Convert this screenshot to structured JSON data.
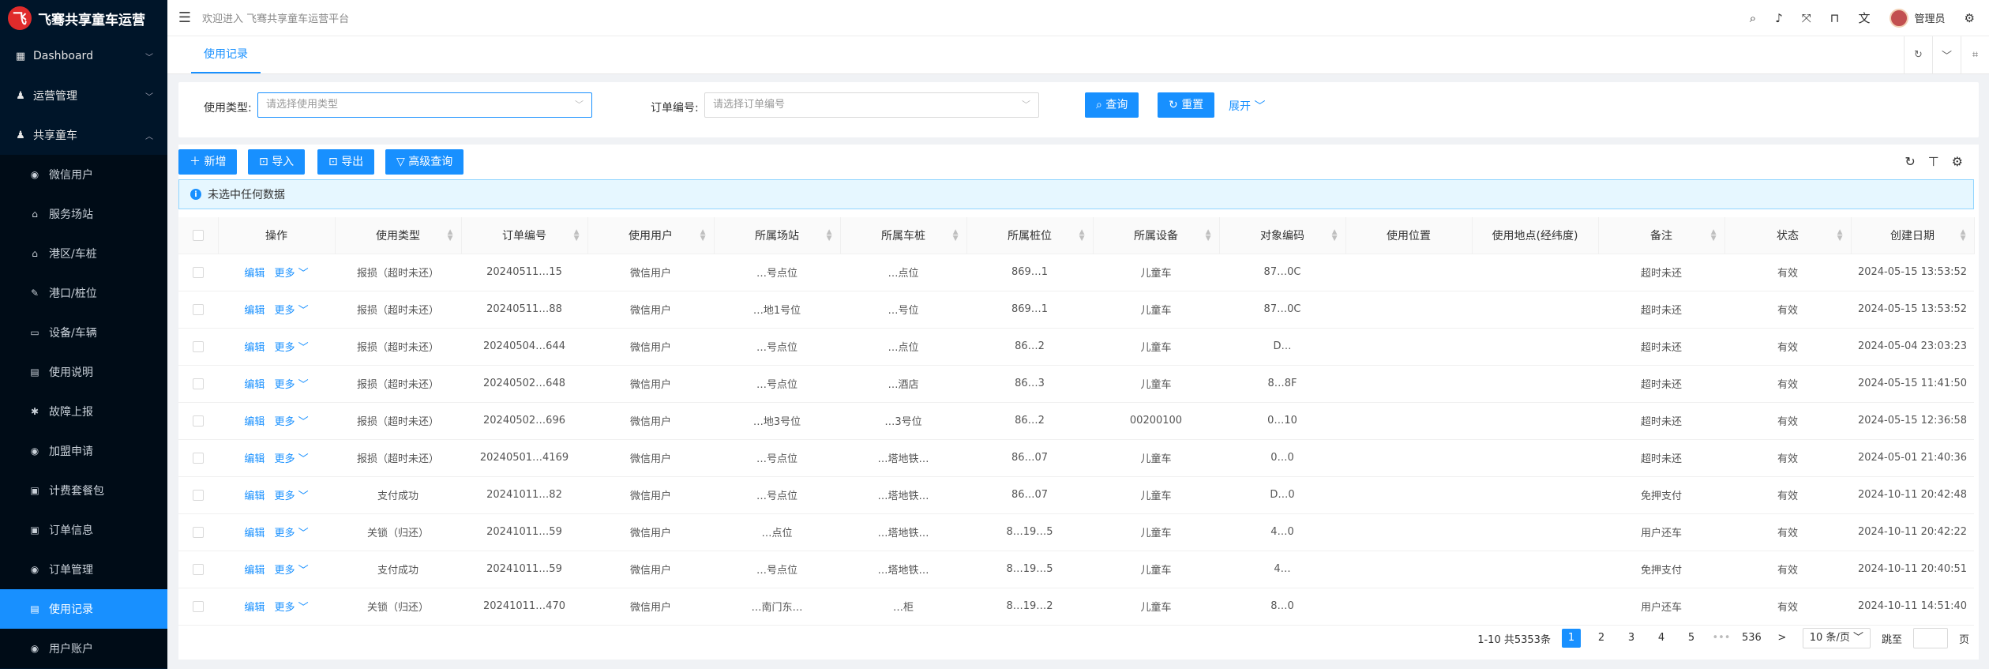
{
  "app": {
    "name": "飞骞共享童车运营",
    "logo_char": "飞"
  },
  "sidebar": {
    "groups": [
      {
        "label": "Dashboard",
        "icon": "dashboard-icon",
        "glyph": "▦",
        "caret": "﹀"
      },
      {
        "label": "运营管理",
        "icon": "user-icon",
        "glyph": "♟",
        "caret": "﹀"
      },
      {
        "label": "共享童车",
        "icon": "user-icon",
        "glyph": "♟",
        "caret": "︿"
      }
    ],
    "items": [
      {
        "label": "微信用户",
        "glyph": "◉"
      },
      {
        "label": "服务场站",
        "glyph": "⌂"
      },
      {
        "label": "港区/车桩",
        "glyph": "⌂"
      },
      {
        "label": "港口/桩位",
        "glyph": "✎"
      },
      {
        "label": "设备/车辆",
        "glyph": "▭"
      },
      {
        "label": "使用说明",
        "glyph": "▤"
      },
      {
        "label": "故障上报",
        "glyph": "✱"
      },
      {
        "label": "加盟申请",
        "glyph": "◉"
      },
      {
        "label": "计费套餐包",
        "glyph": "▣"
      },
      {
        "label": "订单信息",
        "glyph": "▣"
      },
      {
        "label": "订单管理",
        "glyph": "◉"
      },
      {
        "label": "使用记录",
        "glyph": "▤",
        "active": true
      },
      {
        "label": "用户账户",
        "glyph": "◉"
      }
    ]
  },
  "header": {
    "welcome": "欢迎进入 飞骞共享童车运营平台",
    "username": "管理员",
    "icons": [
      "search-icon",
      "bell-icon",
      "fullscreen-icon",
      "lock-icon",
      "language-icon",
      "gear-icon"
    ]
  },
  "tabs": {
    "active": "使用记录"
  },
  "search": {
    "type_label": "使用类型:",
    "type_placeholder": "请选择使用类型",
    "order_label": "订单编号:",
    "order_placeholder": "请选择订单编号",
    "query_label": "查询",
    "reset_label": "重置",
    "expand_label": "展开"
  },
  "toolbar": {
    "add_label": "新增",
    "import_label": "导入",
    "export_label": "导出",
    "advanced_label": "高级查询"
  },
  "alert": {
    "text": "未选中任何数据"
  },
  "table": {
    "columns": [
      "操作",
      "使用类型",
      "订单编号",
      "使用用户",
      "所属场站",
      "所属车桩",
      "所属桩位",
      "所属设备",
      "对象编码",
      "使用位置",
      "使用地点(经纬度)",
      "备注",
      "状态",
      "创建日期"
    ],
    "edit_label": "编辑",
    "more_label": "更多 ﹀",
    "rows": [
      [
        "报损（超时未还）",
        "20240511…15",
        "微信用户",
        "…号点位",
        "…点位",
        "869…1",
        "儿童车",
        "87…0C",
        "",
        "",
        "超时未还",
        "有效",
        "2024-05-15 13:53:52"
      ],
      [
        "报损（超时未还）",
        "20240511…88",
        "微信用户",
        "…地1号位",
        "…号位",
        "869…1",
        "儿童车",
        "87…0C",
        "",
        "",
        "超时未还",
        "有效",
        "2024-05-15 13:53:52"
      ],
      [
        "报损（超时未还）",
        "20240504…644",
        "微信用户",
        "…号点位",
        "…点位",
        "86…2",
        "儿童车",
        "D…",
        "",
        "",
        "超时未还",
        "有效",
        "2024-05-04 23:03:23"
      ],
      [
        "报损（超时未还）",
        "20240502…648",
        "微信用户",
        "…号点位",
        "…酒店",
        "86…3",
        "儿童车",
        "8…8F",
        "",
        "",
        "超时未还",
        "有效",
        "2024-05-15 11:41:50"
      ],
      [
        "报损（超时未还）",
        "20240502…696",
        "微信用户",
        "…地3号位",
        "…3号位",
        "86…2",
        "00200100",
        "0…10",
        "",
        "",
        "超时未还",
        "有效",
        "2024-05-15 12:36:58"
      ],
      [
        "报损（超时未还）",
        "20240501…4169",
        "微信用户",
        "…号点位",
        "…塔地铁…",
        "86…07",
        "儿童车",
        "0…0",
        "",
        "",
        "超时未还",
        "有效",
        "2024-05-01 21:40:36"
      ],
      [
        "支付成功",
        "20241011…82",
        "微信用户",
        "…号点位",
        "…塔地铁…",
        "86…07",
        "儿童车",
        "D…0",
        "",
        "",
        "免押支付",
        "有效",
        "2024-10-11 20:42:48"
      ],
      [
        "关锁（归还）",
        "20241011…59",
        "微信用户",
        "…点位",
        "…塔地铁…",
        "8…19…5",
        "儿童车",
        "4…0",
        "",
        "",
        "用户还车",
        "有效",
        "2024-10-11 20:42:22"
      ],
      [
        "支付成功",
        "20241011…59",
        "微信用户",
        "…号点位",
        "…塔地铁…",
        "8…19…5",
        "儿童车",
        "4…",
        "",
        "",
        "免押支付",
        "有效",
        "2024-10-11 20:40:51"
      ],
      [
        "关锁（归还）",
        "20241011…470",
        "微信用户",
        "…南门东…",
        "…柜",
        "8…19…2",
        "儿童车",
        "8…0",
        "",
        "",
        "用户还车",
        "有效",
        "2024-10-11 14:51:40"
      ]
    ]
  },
  "pagination": {
    "summary": "1-10 共5353条",
    "pages": [
      "1",
      "2",
      "3",
      "4",
      "5"
    ],
    "ellipsis": "•••",
    "last": "536",
    "next": ">",
    "size": "10 条/页 ﹀",
    "jump_label": "跳至",
    "page_suffix": "页"
  }
}
